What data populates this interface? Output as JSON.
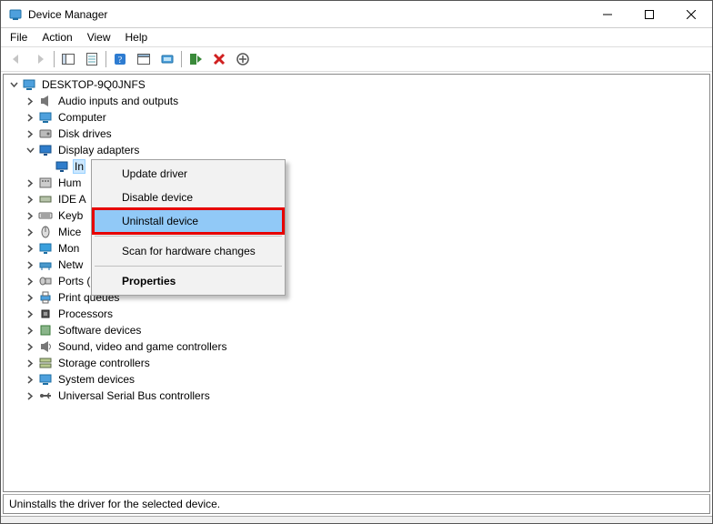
{
  "window": {
    "title": "Device Manager"
  },
  "menubar": {
    "file": "File",
    "action": "Action",
    "view": "View",
    "help": "Help"
  },
  "toolbar": {
    "back": "Back",
    "forward": "Forward",
    "show_hide_tree": "Show/Hide console tree",
    "properties": "Properties",
    "help": "Help",
    "actioncenter": "Show Action Center",
    "update_driver_tool": "Update driver",
    "scan": "Scan for hardware changes",
    "uninstall": "Uninstall device",
    "add_legacy": "Add legacy hardware"
  },
  "tree": {
    "root": "DESKTOP-9Q0JNFS",
    "items": [
      {
        "label": "Audio inputs and outputs",
        "icon": "audio"
      },
      {
        "label": "Computer",
        "icon": "computer"
      },
      {
        "label": "Disk drives",
        "icon": "disk"
      },
      {
        "label": "Display adapters",
        "icon": "display",
        "expanded": true,
        "child": "In"
      },
      {
        "label": "Hum",
        "icon": "hid"
      },
      {
        "label": "IDE A",
        "icon": "ide"
      },
      {
        "label": "Keyb",
        "icon": "keyboard"
      },
      {
        "label": "Mice",
        "icon": "mouse"
      },
      {
        "label": "Mon",
        "icon": "monitor"
      },
      {
        "label": "Netw",
        "icon": "network"
      },
      {
        "label": "Ports (COM & LPT)",
        "icon": "port"
      },
      {
        "label": "Print queues",
        "icon": "printer"
      },
      {
        "label": "Processors",
        "icon": "cpu"
      },
      {
        "label": "Software devices",
        "icon": "software"
      },
      {
        "label": "Sound, video and game controllers",
        "icon": "sound"
      },
      {
        "label": "Storage controllers",
        "icon": "storage"
      },
      {
        "label": "System devices",
        "icon": "system"
      },
      {
        "label": "Universal Serial Bus controllers",
        "icon": "usb"
      }
    ]
  },
  "context_menu": {
    "update_driver": "Update driver",
    "disable_device": "Disable device",
    "uninstall_device": "Uninstall device",
    "scan_hardware": "Scan for hardware changes",
    "properties": "Properties"
  },
  "statusbar": {
    "text": "Uninstalls the driver for the selected device."
  }
}
